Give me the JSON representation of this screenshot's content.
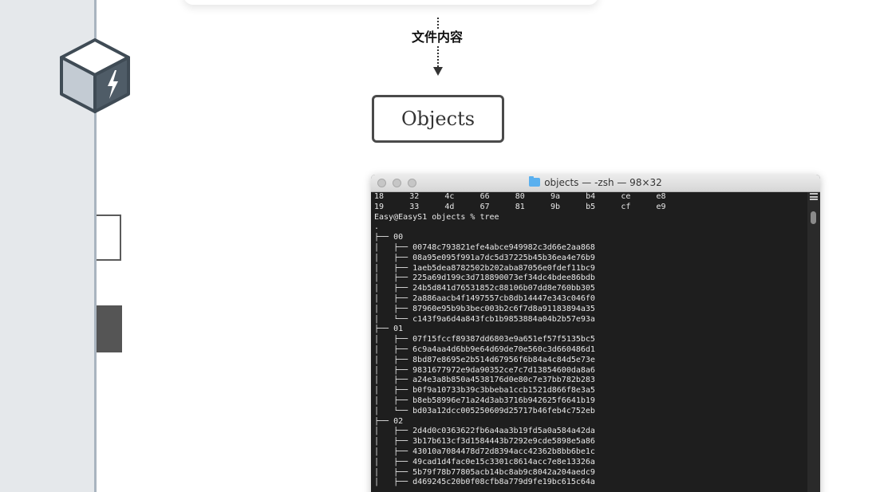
{
  "slide": {
    "flow_label": "文件内容",
    "objects_box_label": "Objects"
  },
  "terminal": {
    "title": "objects — -zsh — 98×32",
    "ls_rows": [
      [
        "18",
        "32",
        "4c",
        "66",
        "80",
        "9a",
        "b4",
        "ce",
        "e8"
      ],
      [
        "19",
        "33",
        "4d",
        "67",
        "81",
        "9b",
        "b5",
        "cf",
        "e9"
      ]
    ],
    "lines": [
      "Easy@EasyS1 objects % tree",
      ".",
      "├── 00",
      "│   ├── 00748c793821efe4abce949982c3d66e2aa868",
      "│   ├── 08a95e095f991a7dc5d37225b45b36ea4e76b9",
      "│   ├── 1aeb5dea8782502b202aba87056e0fdef11bc9",
      "│   ├── 225a69d199c3d718890073ef34dc4bdee86bdb",
      "│   ├── 24b5d841d76531852c88106b07dd8e760bb305",
      "│   ├── 2a886aacb4f1497557cb8db14447e343c046f0",
      "│   ├── 87960e95b9b3bec003b2c6f7d8a91183894a35",
      "│   └── c143f9a6d4a843fcb1b9853884a04b2b57e93a",
      "├── 01",
      "│   ├── 07f15fccf89387dd6803e9a651ef57f5135bc5",
      "│   ├── 6c9a4aa4d6bb9e64d69de70e560c3d660486d1",
      "│   ├── 8bd87e8695e2b514d67956f6b84a4c84d5e73e",
      "│   ├── 9831677972e9da90352ce7c7d13854600da8a6",
      "│   ├── a24e3a8b850a4538176d0e80c7e37bb782b283",
      "│   ├── b0f9a10733b39c3bbeba1ccb1521d866f8e3a5",
      "│   ├── b8eb58996e71a24d3ab3716b942625f6641b19",
      "│   └── bd03a12dcc005250609d25717b46feb4c752eb",
      "├── 02",
      "│   ├── 2d4d0c0363622fb6a4aa3b19fd5a0a584a42da",
      "│   ├── 3b17b613cf3d1584443b7292e9cde5898e5a86",
      "│   ├── 43010a7084478d72d8394acc42362b8bb6be1c",
      "│   ├── 49cad1d4fac0e15c3301c8614acc7e8e13326a",
      "│   ├── 5b79f78b77805acb14bc8ab9c8042a204aedc9",
      "│   ├── d469245c20b0f08cfb8a779d9fe19bc615c64a"
    ]
  }
}
